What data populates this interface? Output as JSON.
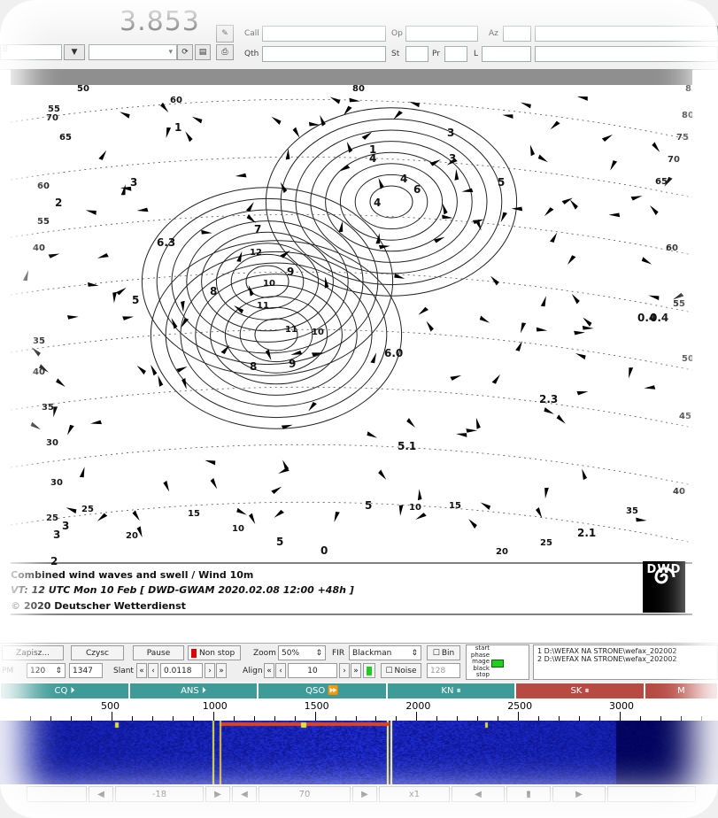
{
  "top": {
    "frequency": "3.853",
    "mode_partial": "B",
    "fields": {
      "call": "Call",
      "qth": "Qth",
      "op": "Op",
      "st": "St",
      "pr": "Pr",
      "az": "Az",
      "l": "L"
    }
  },
  "fax": {
    "caption_line1": "Combined wind waves and swell / Wind 10m",
    "caption_line2": "VT:  12 UTC Mon 10 Feb [ DWD-GWAM 2020.02.08 12:00  +48h ]",
    "caption_line3": "© 2020 Deutscher Wetterdienst",
    "logo_text": "DWD",
    "map_labels": [
      "50",
      "55",
      "60",
      "80",
      "70",
      "65",
      "60",
      "55",
      "40",
      "35",
      "40",
      "35",
      "30",
      "30",
      "25",
      "20",
      "25",
      "15",
      "10",
      "5",
      "0",
      "5",
      "10",
      "15",
      "20",
      "25",
      "35",
      "40",
      "45",
      "50",
      "55",
      "60",
      "65",
      "70",
      "75",
      "80",
      "85",
      "2",
      "3",
      "1",
      "3",
      "4",
      "4",
      "5",
      "6.3",
      "12",
      "8",
      "11",
      "7",
      "9",
      "10",
      "9",
      "8",
      "11",
      "10",
      "4",
      "6",
      "1",
      "3",
      "5",
      "6.0",
      "0.4",
      "2.3",
      "5.1",
      "3",
      "2",
      "3",
      "2.1",
      "0.4"
    ]
  },
  "controls": {
    "zapisz": "Zapisz...",
    "czysc": "Czysc",
    "pause": "Pause",
    "non_stop": "Non stop",
    "zoom_label": "Zoom",
    "zoom_value": "50%",
    "fir_label": "FIR",
    "fir_value": "Blackman",
    "bin": "Bin",
    "lpm_label": "PM",
    "lpm_value": "120",
    "width_value": "1347",
    "slant_label": "Slant",
    "slant_value": "0.0118",
    "align_label": "Align",
    "align_value": "10",
    "noise": "Noise",
    "noise_value": "128",
    "status": [
      "start",
      "phase",
      "mage",
      "black",
      "stop"
    ],
    "files": [
      "1 D:\\WEFAX NA STRONE\\wefax_202002",
      "2 D:\\WEFAX NA STRONE\\wefax_202002"
    ]
  },
  "macros": [
    {
      "label": "CQ ⏵",
      "color": "#3f9b97"
    },
    {
      "label": "ANS ⏵",
      "color": "#3f9b97"
    },
    {
      "label": "QSO ⏩",
      "color": "#3f9b97"
    },
    {
      "label": "KN ⏸",
      "color": "#3f9b97"
    },
    {
      "label": "SK ⏸",
      "color": "#b74a43"
    },
    {
      "label": "M",
      "color": "#b74a43"
    }
  ],
  "scale": {
    "labels": [
      "500",
      "1000",
      "1500",
      "2000",
      "2500",
      "3000"
    ]
  },
  "bottom": {
    "squelch": "-18",
    "value2": "70",
    "speed": "x1"
  }
}
